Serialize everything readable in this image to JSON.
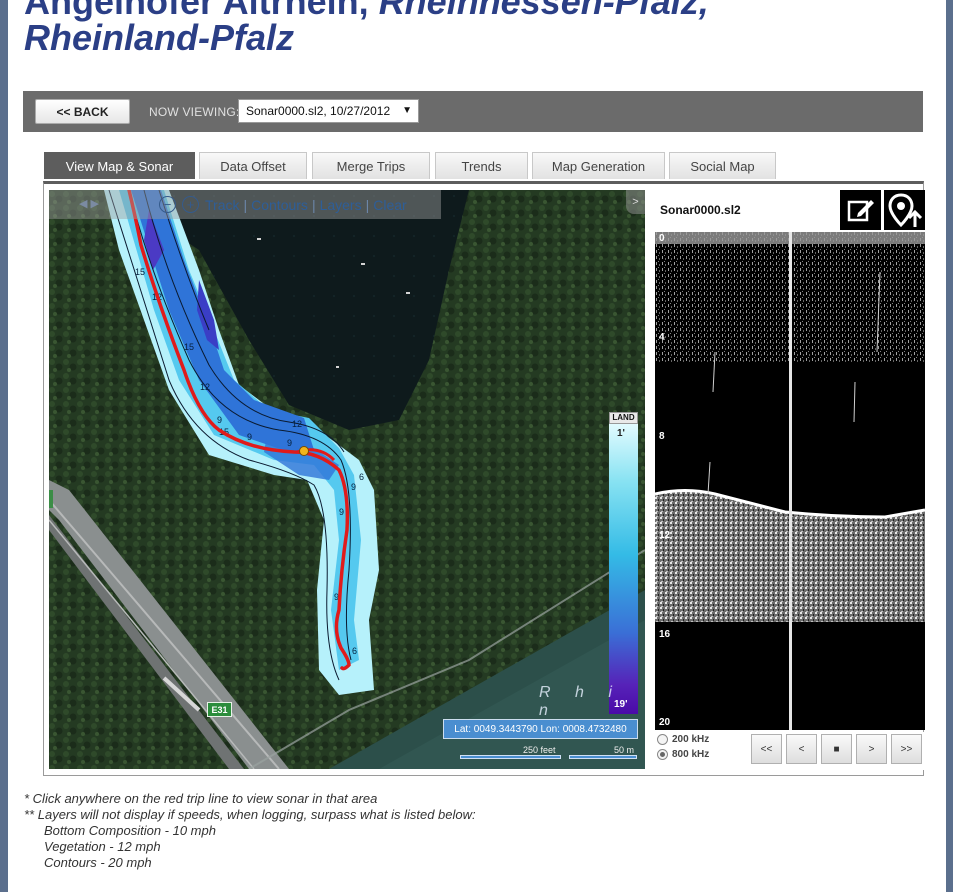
{
  "page": {
    "title_part1": "Angelhofer Altrhein, ",
    "title_part2": "Rheinhessen-Pfalz,",
    "title_line2": "Rheinland-Pfalz"
  },
  "toolbar": {
    "back_label": "<< BACK",
    "now_viewing_label": "NOW VIEWING:",
    "selected_trip": "Sonar0000.sl2, 10/27/2012",
    "select_arrow": "▼"
  },
  "tabs": [
    {
      "label": "View Map & Sonar",
      "active": true
    },
    {
      "label": "Data Offset",
      "active": false
    },
    {
      "label": "Merge Trips",
      "active": false
    },
    {
      "label": "Trends",
      "active": false
    },
    {
      "label": "Map Generation",
      "active": false
    },
    {
      "label": "Social Map",
      "active": false
    }
  ],
  "map": {
    "nav_glyphs": "◀ ▶",
    "zoom_out_glyph": "−",
    "zoom_in_glyph": "+",
    "track_label": "Track",
    "contours_label": "Contours",
    "layers_label": "Layers",
    "clear_label": "Clear",
    "separator": "|",
    "collapse_glyph": ">",
    "legend_top": "LAND",
    "legend_min": "1'",
    "legend_max": "19'",
    "river_label": "R h i n",
    "coordinates": "Lat: 0049.3443790 Lon: 0008.4732480",
    "scale_feet": "250 feet",
    "scale_meters": "50 m",
    "road_badge": "E31",
    "contour_labels": [
      "15",
      "12",
      "15",
      "12",
      "9",
      "9",
      "9",
      "12",
      "9",
      "6",
      "9",
      "15",
      "9",
      "6"
    ],
    "colors": {
      "track": "#e01b1b",
      "shallow": "#aeeefa",
      "mid": "#3fb4ea",
      "deep": "#3346c8",
      "position_marker": "#f2b51b"
    }
  },
  "sonar": {
    "filename": "Sonar0000.sl2",
    "edit_icon": "edit-icon",
    "upload_icon": "map-pin-upload-icon",
    "depth_labels": [
      "0",
      "4",
      "8",
      "12",
      "16",
      "20"
    ],
    "freq_200": "200 kHz",
    "freq_800": "800 kHz",
    "selected_freq": "800 kHz",
    "playback": [
      "<<",
      "<",
      "■",
      ">",
      ">>"
    ]
  },
  "notes": {
    "line1": "* Click anywhere on the red trip line to view sonar in that area",
    "line2": "** Layers will not display if speeds, when logging, surpass what is listed below:",
    "line3": "Bottom Composition - 10 mph",
    "line4": "Vegetation - 12 mph",
    "line5": "Contours - 20 mph"
  }
}
